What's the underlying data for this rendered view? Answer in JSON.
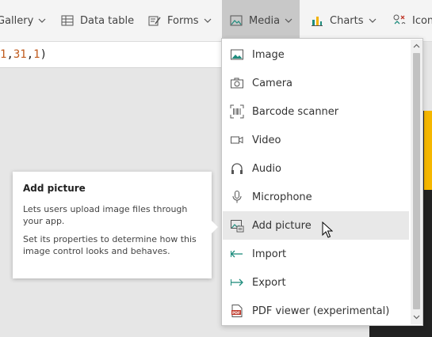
{
  "ribbon": {
    "gallery": "Gallery",
    "data_table": "Data table",
    "forms": "Forms",
    "media": "Media",
    "charts": "Charts",
    "icons": "Icons"
  },
  "formula": {
    "part1": "1",
    "sep1": ", ",
    "part2": "31",
    "sep2": ", ",
    "part3": "1",
    "close": ")"
  },
  "menu": {
    "items": [
      {
        "label": "Image",
        "icon": "image-icon"
      },
      {
        "label": "Camera",
        "icon": "camera-icon"
      },
      {
        "label": "Barcode scanner",
        "icon": "barcode-icon"
      },
      {
        "label": "Video",
        "icon": "video-icon"
      },
      {
        "label": "Audio",
        "icon": "headphones-icon"
      },
      {
        "label": "Microphone",
        "icon": "microphone-icon"
      },
      {
        "label": "Add picture",
        "icon": "add-picture-icon"
      },
      {
        "label": "Import",
        "icon": "import-icon"
      },
      {
        "label": "Export",
        "icon": "export-icon"
      },
      {
        "label": "PDF viewer (experimental)",
        "icon": "pdf-icon"
      }
    ],
    "hovered": "Add picture"
  },
  "tooltip": {
    "title": "Add picture",
    "line1": "Lets users upload image files through your app.",
    "line2": "Set its properties to determine how this image control looks and behaves."
  },
  "colors": {
    "accent_teal": "#1e8c7d",
    "formula_number": "#c05a1c",
    "canvas_yellow": "#f5b700"
  }
}
